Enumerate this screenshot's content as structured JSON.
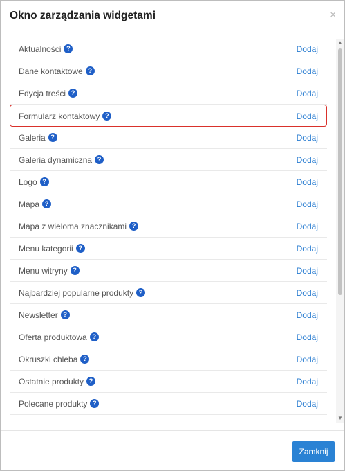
{
  "dialog": {
    "title": "Okno zarządzania widgetami",
    "close_symbol": "×"
  },
  "widgets": [
    {
      "name": "Aktualności",
      "action": "Dodaj"
    },
    {
      "name": "Dane kontaktowe",
      "action": "Dodaj"
    },
    {
      "name": "Edycja treści",
      "action": "Dodaj"
    },
    {
      "name": "Formularz kontaktowy",
      "action": "Dodaj",
      "highlighted": true
    },
    {
      "name": "Galeria",
      "action": "Dodaj"
    },
    {
      "name": "Galeria dynamiczna",
      "action": "Dodaj"
    },
    {
      "name": "Logo",
      "action": "Dodaj"
    },
    {
      "name": "Mapa",
      "action": "Dodaj"
    },
    {
      "name": "Mapa z wieloma znacznikami",
      "action": "Dodaj"
    },
    {
      "name": "Menu kategorii",
      "action": "Dodaj"
    },
    {
      "name": "Menu witryny",
      "action": "Dodaj"
    },
    {
      "name": "Najbardziej popularne produkty",
      "action": "Dodaj"
    },
    {
      "name": "Newsletter",
      "action": "Dodaj"
    },
    {
      "name": "Oferta produktowa",
      "action": "Dodaj"
    },
    {
      "name": "Okruszki chleba",
      "action": "Dodaj"
    },
    {
      "name": "Ostatnie produkty",
      "action": "Dodaj"
    },
    {
      "name": "Polecane produkty",
      "action": "Dodaj"
    }
  ],
  "help_icon": {
    "name": "question-circle-icon",
    "glyph": "?",
    "color": "#1f5fc7"
  },
  "highlight_color": "#d9312b",
  "link_color": "#2a7dd1",
  "footer": {
    "close_button_label": "Zamknij",
    "button_color": "#2a82d4"
  }
}
